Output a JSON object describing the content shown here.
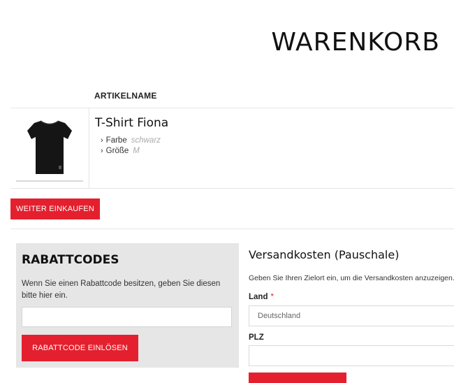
{
  "page": {
    "title": "WARENKORB"
  },
  "cart": {
    "column_header": "ARTIKELNAME",
    "item": {
      "name": "T-Shirt Fiona",
      "attributes": [
        {
          "label": "Farbe",
          "value": "schwarz"
        },
        {
          "label": "Größe",
          "value": "M"
        }
      ]
    },
    "continue_button": "WEITER EINKAUFEN"
  },
  "coupon": {
    "title": "RABATTCODES",
    "description": "Wenn Sie einen Rabattcode besitzen, geben Sie diesen bitte hier ein.",
    "input_value": "",
    "submit_button": "RABATTCODE EINLÖSEN"
  },
  "shipping": {
    "title": "Versandkosten (Pauschale)",
    "description": "Geben Sie Ihren Zielort ein, um die Versandkosten anzuzeigen.",
    "country_label": "Land",
    "required_marker": "*",
    "country_value": "Deutschland",
    "zip_label": "PLZ",
    "zip_value": ""
  },
  "colors": {
    "accent": "#e4202e",
    "panel": "#e6e6e6"
  }
}
